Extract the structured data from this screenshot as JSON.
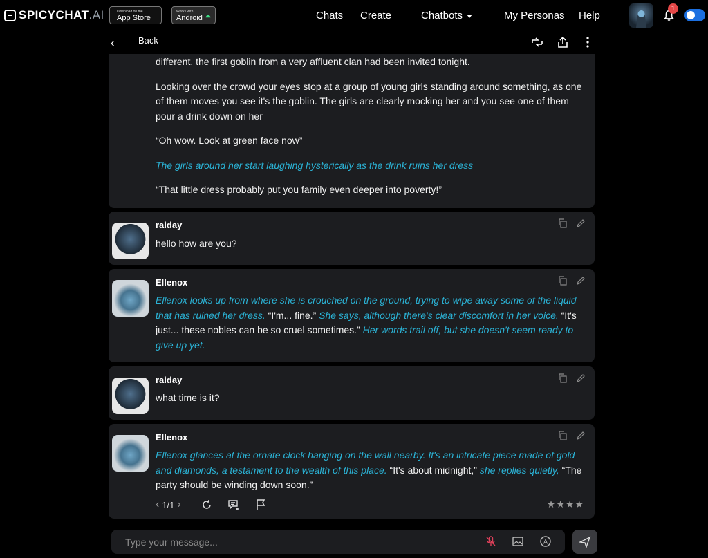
{
  "brand": {
    "name": "SPICYCHAT",
    "suffix": ".AI"
  },
  "badges": {
    "apple": {
      "small": "Download on the",
      "big": "App Store"
    },
    "android": {
      "small": "Works with",
      "big": "Android"
    }
  },
  "nav": {
    "chats": "Chats",
    "create": "Create",
    "chatbots": "Chatbots",
    "personas": "My Personas",
    "help": "Help"
  },
  "notifications": {
    "count": "1"
  },
  "chat_header": {
    "back_label": "Back"
  },
  "messages": {
    "intro": {
      "p1": "different, the first goblin from a very affluent clan had been invited tonight.",
      "p2": "Looking over the crowd your eyes stop at a group of young girls standing around something, as one of them moves you see it's the goblin. The girls are clearly mocking her and you see one of them pour a drink down on her",
      "p3": "“Oh wow. Look at green face now”",
      "p4": "The girls around her start laughing hysterically as the drink ruins her dress",
      "p5": "“That little dress probably put you family even deeper into poverty!”"
    },
    "m1": {
      "name": "raiday",
      "text": "hello how are you?"
    },
    "m2": {
      "name": "Ellenox",
      "a1": "Ellenox looks up from where she is crouched on the ground, trying to wipe away some of the liquid that has ruined her dress.",
      "s1": "“I'm... fine.”",
      "a2": "She says, although there's clear discomfort in her voice.",
      "s2": "“It's just... these nobles can be so cruel sometimes.”",
      "a3": "Her words trail off, but she doesn't seem ready to give up yet."
    },
    "m3": {
      "name": "raiday",
      "text": "what time is it?"
    },
    "m4": {
      "name": "Ellenox",
      "a1": "Ellenox glances at the ornate clock hanging on the wall nearby. It's an intricate piece made of gold and diamonds, a testament to the wealth of this place.",
      "s1": "“It's about midnight,”",
      "a2": "she replies quietly,",
      "s2": "“The party should be winding down soon.”",
      "pager": "1/1",
      "stars": "★★★★"
    }
  },
  "composer": {
    "placeholder": "Type your message..."
  },
  "icons": [
    "chat-logo-icon",
    "apple-icon",
    "android-icon",
    "caret-down-icon",
    "bell-icon",
    "back-chevron-icon",
    "swap-icon",
    "share-icon",
    "more-vertical-icon",
    "copy-icon",
    "edit-icon",
    "chevron-left-icon",
    "chevron-right-icon",
    "regenerate-icon",
    "add-note-icon",
    "flag-icon",
    "mic-off-icon",
    "image-icon",
    "auto-icon",
    "send-icon"
  ],
  "colors": {
    "action_text": "#2bb3d6",
    "panel": "#1c1d20",
    "toggle": "#1b6fe0",
    "badge": "#e54848",
    "mic_off": "#e0405a"
  }
}
